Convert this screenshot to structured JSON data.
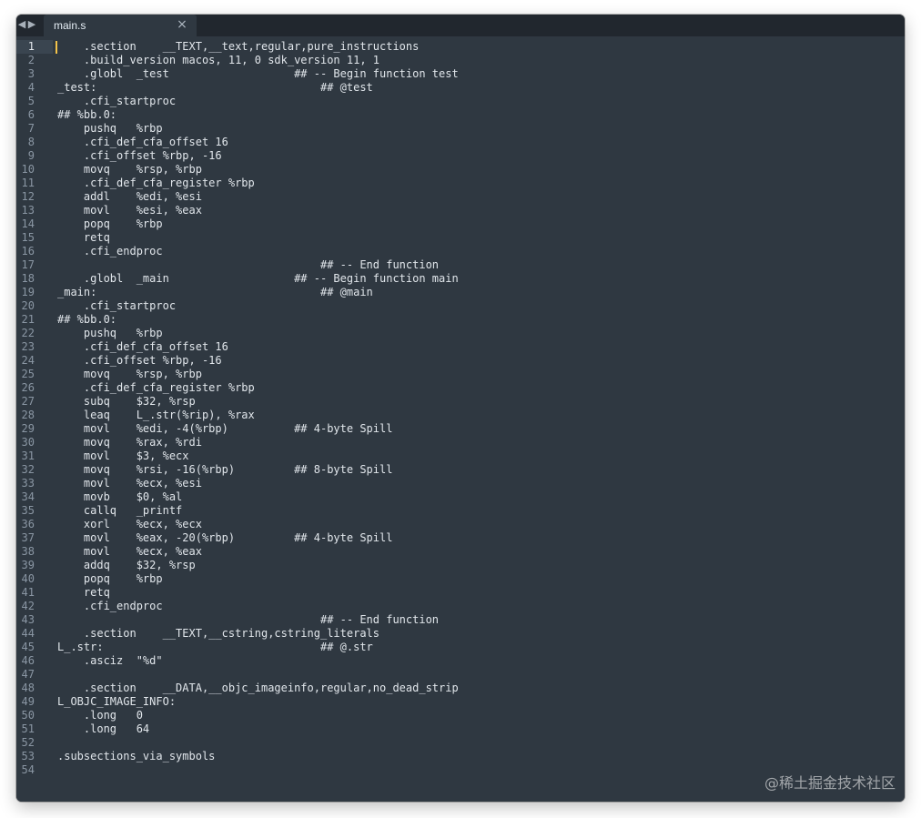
{
  "tab": {
    "title": "main.s",
    "close_glyph": "×"
  },
  "nav": {
    "back_glyph": "◀",
    "forward_glyph": "▶"
  },
  "editor": {
    "active_line": 1,
    "line_numbers": [
      "1",
      "2",
      "3",
      "4",
      "5",
      "6",
      "7",
      "8",
      "9",
      "10",
      "11",
      "12",
      "13",
      "14",
      "15",
      "16",
      "17",
      "18",
      "19",
      "20",
      "21",
      "22",
      "23",
      "24",
      "25",
      "26",
      "27",
      "28",
      "29",
      "30",
      "31",
      "32",
      "33",
      "34",
      "35",
      "36",
      "37",
      "38",
      "39",
      "40",
      "41",
      "42",
      "43",
      "44",
      "45",
      "46",
      "47",
      "48",
      "49",
      "50",
      "51",
      "52",
      "53",
      "54"
    ],
    "lines": [
      "    .section    __TEXT,__text,regular,pure_instructions",
      "    .build_version macos, 11, 0 sdk_version 11, 1",
      "    .globl  _test                   ## -- Begin function test",
      "_test:                                  ## @test",
      "    .cfi_startproc",
      "## %bb.0:",
      "    pushq   %rbp",
      "    .cfi_def_cfa_offset 16",
      "    .cfi_offset %rbp, -16",
      "    movq    %rsp, %rbp",
      "    .cfi_def_cfa_register %rbp",
      "    addl    %edi, %esi",
      "    movl    %esi, %eax",
      "    popq    %rbp",
      "    retq",
      "    .cfi_endproc",
      "                                        ## -- End function",
      "    .globl  _main                   ## -- Begin function main",
      "_main:                                  ## @main",
      "    .cfi_startproc",
      "## %bb.0:",
      "    pushq   %rbp",
      "    .cfi_def_cfa_offset 16",
      "    .cfi_offset %rbp, -16",
      "    movq    %rsp, %rbp",
      "    .cfi_def_cfa_register %rbp",
      "    subq    $32, %rsp",
      "    leaq    L_.str(%rip), %rax",
      "    movl    %edi, -4(%rbp)          ## 4-byte Spill",
      "    movq    %rax, %rdi",
      "    movl    $3, %ecx",
      "    movq    %rsi, -16(%rbp)         ## 8-byte Spill",
      "    movl    %ecx, %esi",
      "    movb    $0, %al",
      "    callq   _printf",
      "    xorl    %ecx, %ecx",
      "    movl    %eax, -20(%rbp)         ## 4-byte Spill",
      "    movl    %ecx, %eax",
      "    addq    $32, %rsp",
      "    popq    %rbp",
      "    retq",
      "    .cfi_endproc",
      "                                        ## -- End function",
      "    .section    __TEXT,__cstring,cstring_literals",
      "L_.str:                                 ## @.str",
      "    .asciz  \"%d\"",
      "",
      "    .section    __DATA,__objc_imageinfo,regular,no_dead_strip",
      "L_OBJC_IMAGE_INFO:",
      "    .long   0",
      "    .long   64",
      "",
      ".subsections_via_symbols",
      ""
    ]
  },
  "watermark": "@稀土掘金技术社区",
  "colors": {
    "background": "#2f3841",
    "tabbar": "#21272e",
    "text": "#e1e6eb",
    "line_number": "#8a96a3",
    "cursor": "#f3c34a"
  }
}
